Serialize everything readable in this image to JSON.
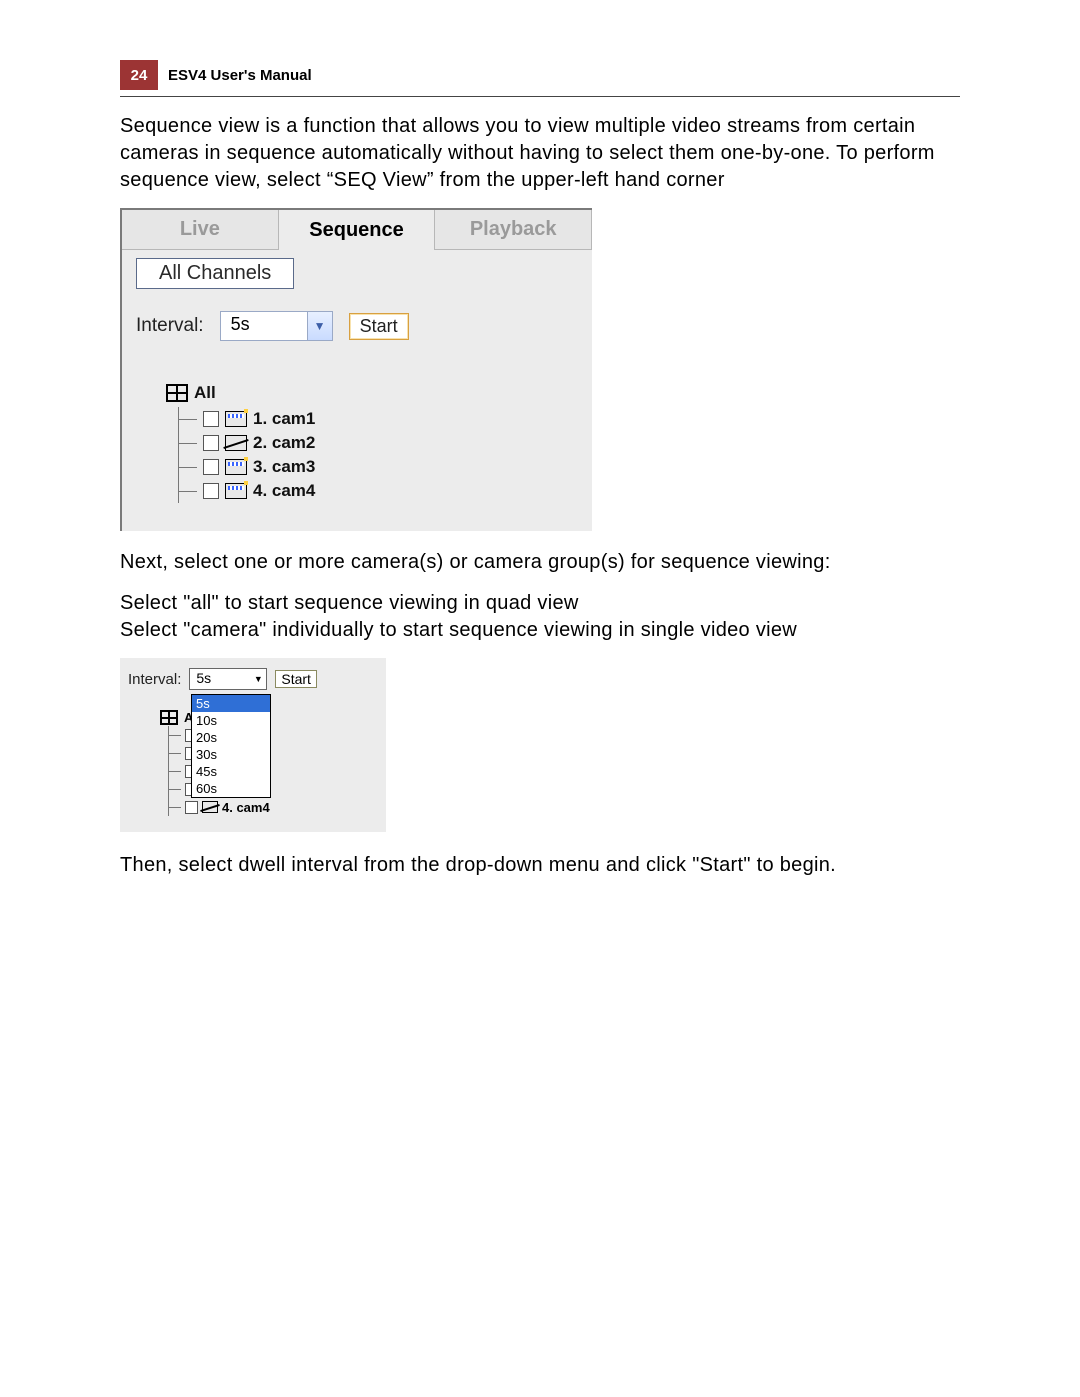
{
  "header": {
    "page_number": "24",
    "title": "ESV4 User's Manual"
  },
  "para1": "Sequence view is a function that allows you to view multiple video streams from certain cameras in sequence automatically without having to select them one-by-one. To perform sequence view, select “SEQ View” from the upper-left hand corner",
  "fig1": {
    "tabs": {
      "live": "Live",
      "sequence": "Sequence",
      "playback": "Playback"
    },
    "all_channels": "All Channels",
    "interval_label": "Interval:",
    "interval_value": "5s",
    "start": "Start",
    "root": "All",
    "cams": [
      "1. cam1",
      "2. cam2",
      "3. cam3",
      "4. cam4"
    ]
  },
  "para2": "Next, select one or more camera(s) or camera group(s) for sequence viewing:",
  "para3a": "Select \"all\" to start sequence viewing in quad view",
  "para3b": "Select \"camera\" individually to start sequence viewing in single video view",
  "fig2": {
    "interval_label": "Interval:",
    "interval_value": "5s",
    "options": [
      "5s",
      "10s",
      "20s",
      "30s",
      "45s",
      "60s"
    ],
    "start": "Start",
    "root": "All",
    "cam4": "4. cam4"
  },
  "para4": "Then, select dwell interval from the drop-down menu and click \"Start\" to begin."
}
